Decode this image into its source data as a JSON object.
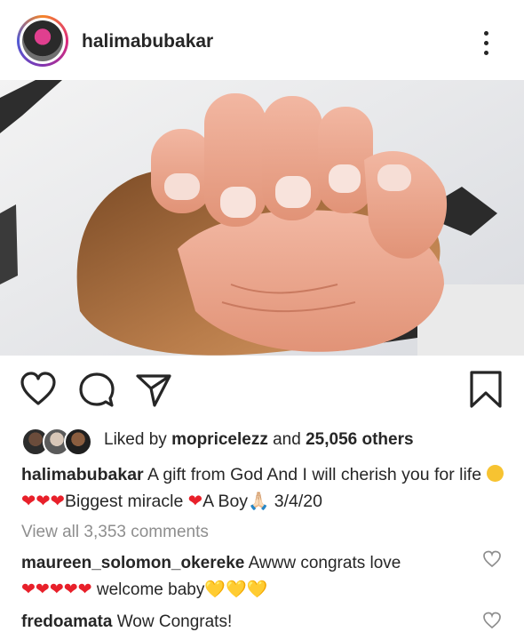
{
  "post": {
    "username": "halimabubakar",
    "icons": {
      "avatar": "profile-photo",
      "more": "vertical-ellipsis-icon",
      "like": "heart-outline-icon",
      "comment": "speech-bubble-icon",
      "share": "paper-plane-icon",
      "save": "bookmark-icon"
    }
  },
  "likes": {
    "prefix": "Liked by",
    "user": "mopricelezz",
    "and": "and",
    "count_text": "25,056 others"
  },
  "caption": {
    "username": "halimabubakar",
    "text_1": "A gift from God And I will cherish you for life",
    "emoji_1": "😩",
    "hearts_1": "❤❤❤",
    "text_2": "Biggest miracle",
    "heart_2": "❤",
    "text_3": "A Boy",
    "emoji_2": "🙏🏻",
    "date": "3/4/20"
  },
  "view_all": "View all 3,353 comments",
  "comments": [
    {
      "username": "maureen_solomon_okereke",
      "text": "Awww congrats love",
      "hearts": "❤❤❤❤❤",
      "text_2": "welcome baby",
      "yellow_hearts": "💛💛💛"
    },
    {
      "username": "fredoamata",
      "text": "Wow Congrats!"
    }
  ],
  "colors": {
    "text": "#262626",
    "muted": "#8e8e8e",
    "heart": "#e8202a",
    "ring_start": "#f58529",
    "ring_end": "#515bd4"
  }
}
